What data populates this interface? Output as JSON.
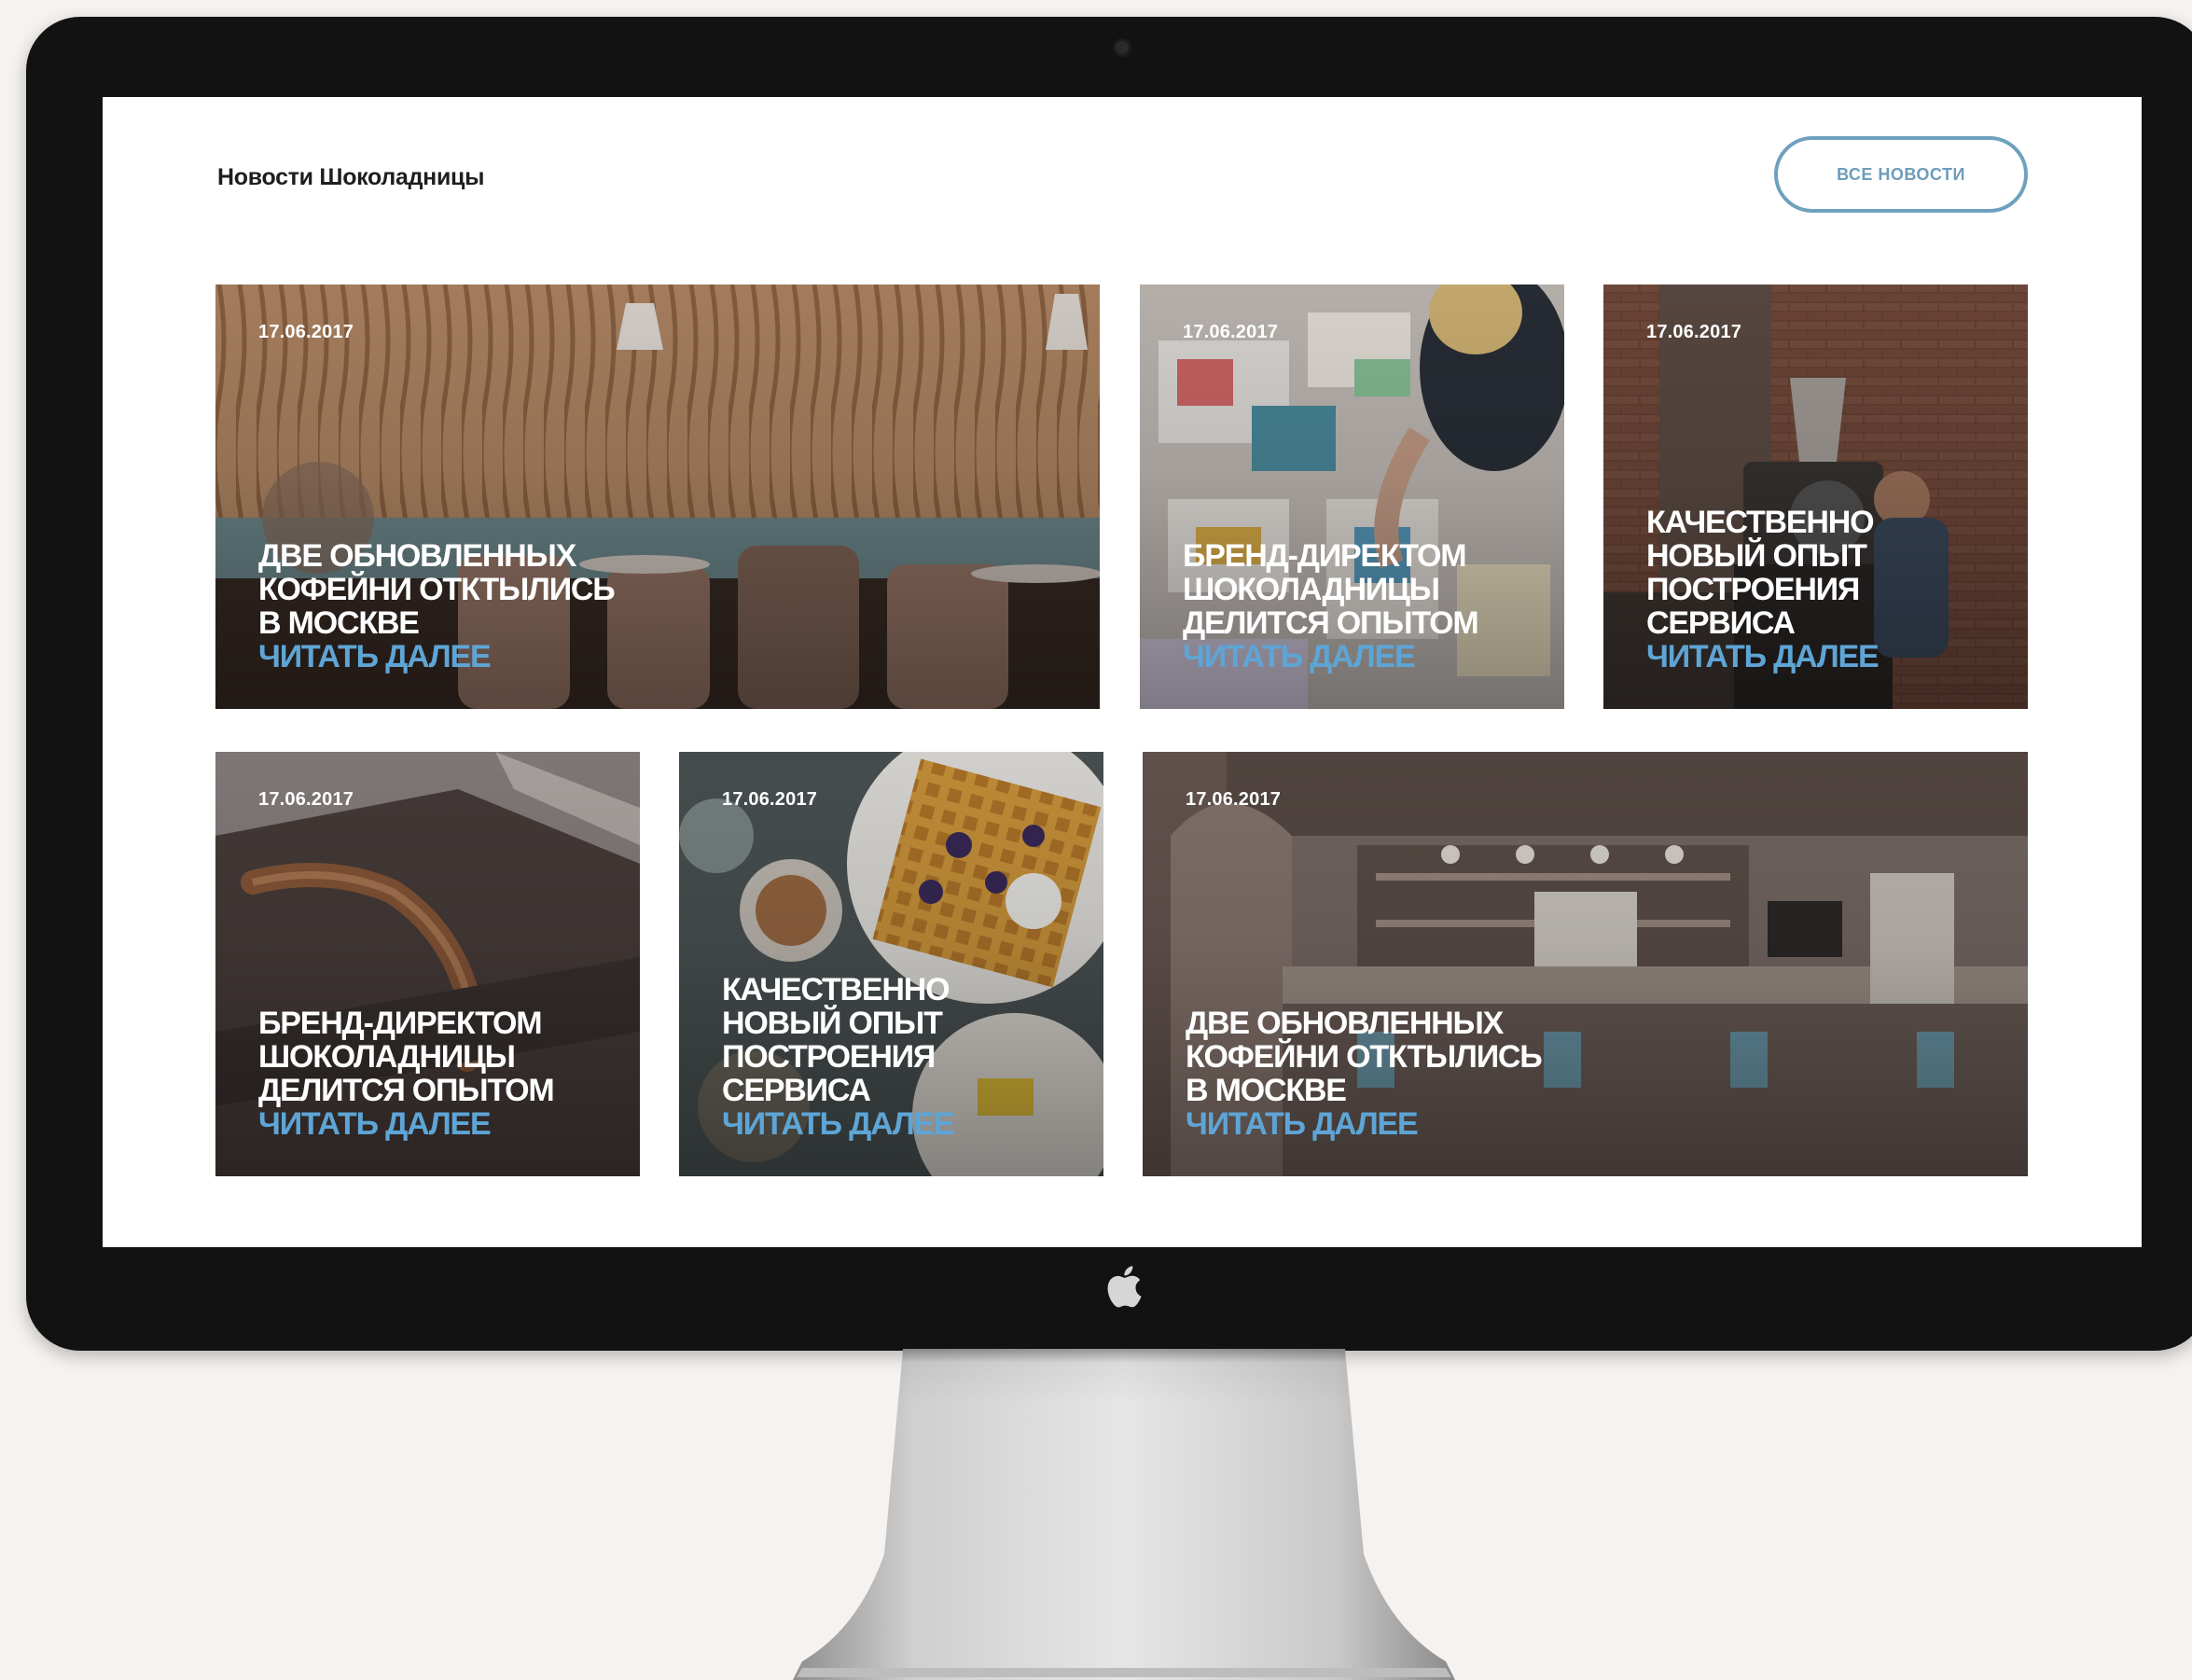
{
  "header": {
    "title": "Новости Шоколадницы",
    "all_news_label": "ВСЕ НОВОСТИ"
  },
  "theme": {
    "accent": "#5ea5d6",
    "button_border": "#6fa0be",
    "bezel": "#121212",
    "backdrop": "#f5f2ef"
  },
  "news": [
    {
      "date": "17.06.2017",
      "title": "ДВЕ ОБНОВЛЕННЫХ\nКОФЕЙНИ ОТКТЫЛИСЬ\nВ МОСКВЕ",
      "read_more": "ЧИТАТЬ ДАЛЕЕ",
      "image": "cafe-interior-wavy-wood-wall"
    },
    {
      "date": "17.06.2017",
      "title": "БРЕНД-ДИРЕКТОМ\nШОКОЛАДНИЦЫ\nДЕЛИТСЯ ОПЫТОМ",
      "read_more": "ЧИТАТЬ ДАЛЕЕ",
      "image": "designer-with-printed-layouts"
    },
    {
      "date": "17.06.2017",
      "title": "КАЧЕСТВЕННО\nНОВЫЙ ОПЫТ\nПОСТРОЕНИЯ\nСЕРВИСА",
      "read_more": "ЧИТАТЬ ДАЛЕЕ",
      "image": "coffee-roaster-brick-wall"
    },
    {
      "date": "17.06.2017",
      "title": "БРЕНД-ДИРЕКТОМ\nШОКОЛАДНИЦЫ\nДЕЛИТСЯ ОПЫТОМ",
      "read_more": "ЧИТАТЬ ДАЛЕЕ",
      "image": "wooden-handle-closeup"
    },
    {
      "date": "17.06.2017",
      "title": "КАЧЕСТВЕННО\nНОВЫЙ ОПЫТ\nПОСТРОЕНИЯ\nСЕРВИСА",
      "read_more": "ЧИТАТЬ ДАЛЕЕ",
      "image": "waffles-breakfast-table"
    },
    {
      "date": "17.06.2017",
      "title": "ДВЕ ОБНОВЛЕННЫХ\nКОФЕЙНИ ОТКТЫЛИСЬ\nВ МОСКВЕ",
      "read_more": "ЧИТАТЬ ДАЛЕЕ",
      "image": "cafe-bar-counter"
    }
  ]
}
